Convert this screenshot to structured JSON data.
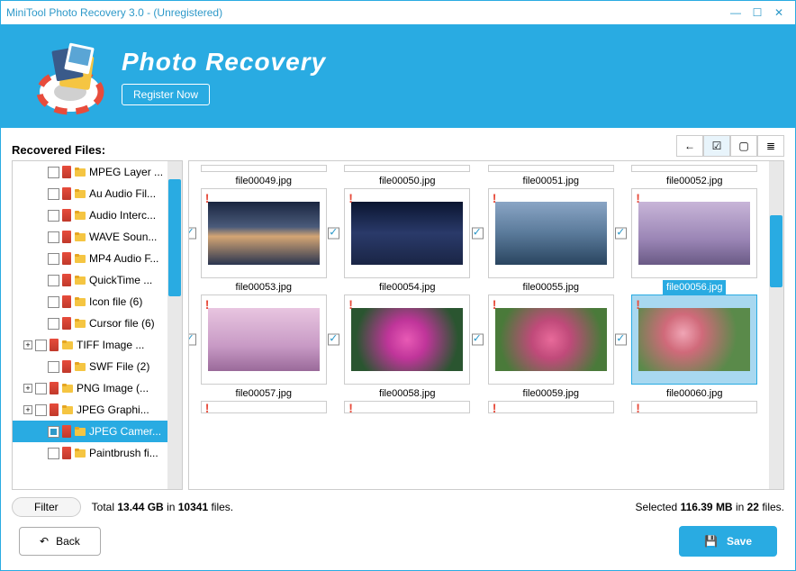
{
  "window": {
    "title": "MiniTool Photo Recovery 3.0 - (Unregistered)"
  },
  "header": {
    "title": "Photo Recovery",
    "register": "Register Now"
  },
  "sidebar": {
    "label": "Recovered Files:",
    "items": [
      {
        "label": "MPEG Layer ...",
        "expand": null,
        "checked": false,
        "level": 1
      },
      {
        "label": "Au Audio Fil...",
        "expand": null,
        "checked": false,
        "level": 1
      },
      {
        "label": "Audio Interc...",
        "expand": null,
        "checked": false,
        "level": 1
      },
      {
        "label": "WAVE Soun...",
        "expand": null,
        "checked": false,
        "level": 1
      },
      {
        "label": "MP4 Audio F...",
        "expand": null,
        "checked": false,
        "level": 1
      },
      {
        "label": "QuickTime ...",
        "expand": null,
        "checked": false,
        "level": 1
      },
      {
        "label": "Icon file (6)",
        "expand": null,
        "checked": false,
        "level": 1
      },
      {
        "label": "Cursor file (6)",
        "expand": null,
        "checked": false,
        "level": 1
      },
      {
        "label": "TIFF Image ...",
        "expand": "+",
        "checked": false,
        "level": 0
      },
      {
        "label": "SWF File (2)",
        "expand": null,
        "checked": false,
        "level": 1
      },
      {
        "label": "PNG Image (...",
        "expand": "+",
        "checked": false,
        "level": 0
      },
      {
        "label": "JPEG Graphi...",
        "expand": "+",
        "checked": false,
        "level": 0
      },
      {
        "label": "JPEG Camer...",
        "expand": null,
        "checked": "partial",
        "level": 1,
        "selected": true
      },
      {
        "label": "Paintbrush fi...",
        "expand": null,
        "checked": false,
        "level": 1
      }
    ]
  },
  "grid": {
    "files": [
      {
        "name": "file00049.jpg",
        "checked": true,
        "warn": true,
        "bg": "linear-gradient(180deg,#1a2540 0%,#4a5b7a 40%,#d4a574 55%,#2a3550 100%)",
        "selected": false
      },
      {
        "name": "file00050.jpg",
        "checked": true,
        "warn": true,
        "bg": "linear-gradient(180deg,#0a1530 0%,#2a3a6a 50%,#1a2545 100%)",
        "selected": false
      },
      {
        "name": "file00051.jpg",
        "checked": true,
        "warn": true,
        "bg": "linear-gradient(180deg,#8aa5c5 0%,#5a7a9a 50%,#2a4560 100%)",
        "selected": false
      },
      {
        "name": "file00052.jpg",
        "checked": true,
        "warn": true,
        "bg": "linear-gradient(180deg,#c8b5d8 0%,#9a85b5 60%,#6a5a85 100%)",
        "selected": false
      },
      {
        "name": "file00053.jpg",
        "checked": true,
        "warn": true,
        "bg": "linear-gradient(180deg,#e8c5e0 0%,#c89ac5 60%,#9a6a9a 100%)",
        "selected": false
      },
      {
        "name": "file00054.jpg",
        "checked": true,
        "warn": true,
        "bg": "radial-gradient(circle at 50% 50%,#e85ab5 0%,#c0359a 30%,#2a5530 80%)",
        "selected": false
      },
      {
        "name": "file00055.jpg",
        "checked": true,
        "warn": true,
        "bg": "radial-gradient(circle at 50% 50%,#e86a9a 0%,#c04a7a 30%,#4a7a3a 80%)",
        "selected": false
      },
      {
        "name": "file00056.jpg",
        "checked": true,
        "warn": true,
        "bg": "radial-gradient(circle at 40% 40%,#f0a5b5 0%,#d06a7a 25%,#5a8a4a 70%)",
        "selected": true
      },
      {
        "name": "file00057.jpg",
        "checked": false,
        "warn": true,
        "bg": "",
        "selected": false,
        "partial": true
      },
      {
        "name": "file00058.jpg",
        "checked": false,
        "warn": true,
        "bg": "",
        "selected": false,
        "partial": true
      },
      {
        "name": "file00059.jpg",
        "checked": false,
        "warn": true,
        "bg": "",
        "selected": false,
        "partial": true
      },
      {
        "name": "file00060.jpg",
        "checked": false,
        "warn": true,
        "bg": "",
        "selected": false,
        "partial": true
      }
    ]
  },
  "status": {
    "filter": "Filter",
    "total_prefix": "Total ",
    "total_size": "13.44 GB",
    "total_mid": " in ",
    "total_count": "10341",
    "total_suffix": " files.",
    "sel_prefix": "Selected ",
    "sel_size": "116.39 MB",
    "sel_mid": " in ",
    "sel_count": "22",
    "sel_suffix": " files."
  },
  "footer": {
    "back": "Back",
    "save": "Save"
  }
}
